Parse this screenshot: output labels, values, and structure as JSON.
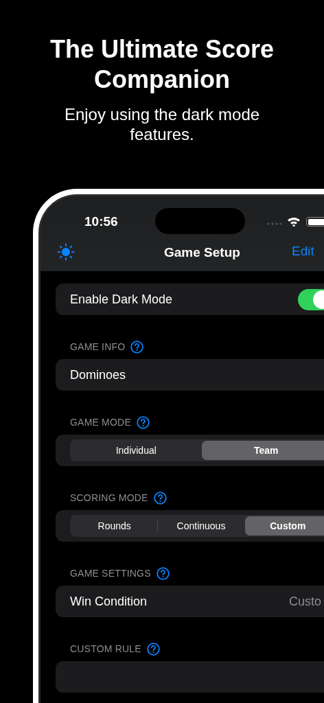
{
  "headline": "The Ultimate Score Companion",
  "subtitle": "Enjoy using the dark mode features.",
  "status_bar": {
    "time": "10:56"
  },
  "nav": {
    "title": "Game Setup",
    "edit": "Edit"
  },
  "dark_mode": {
    "label": "Enable Dark Mode",
    "on": true
  },
  "sections": [
    {
      "header": "GAME INFO",
      "kind": "text",
      "value": "Dominoes"
    },
    {
      "header": "GAME MODE",
      "kind": "segmented",
      "options": [
        {
          "label": "Individual",
          "selected": false
        },
        {
          "label": "Team",
          "selected": true
        }
      ]
    },
    {
      "header": "SCORING MODE",
      "kind": "segmented",
      "options": [
        {
          "label": "Rounds",
          "selected": false
        },
        {
          "label": "Continuous",
          "selected": false
        },
        {
          "label": "Custom",
          "selected": true
        }
      ]
    },
    {
      "header": "GAME SETTINGS",
      "kind": "detail",
      "label": "Win Condition",
      "value": "Custo"
    },
    {
      "header": "CUSTOM RULE",
      "kind": "empty"
    }
  ]
}
